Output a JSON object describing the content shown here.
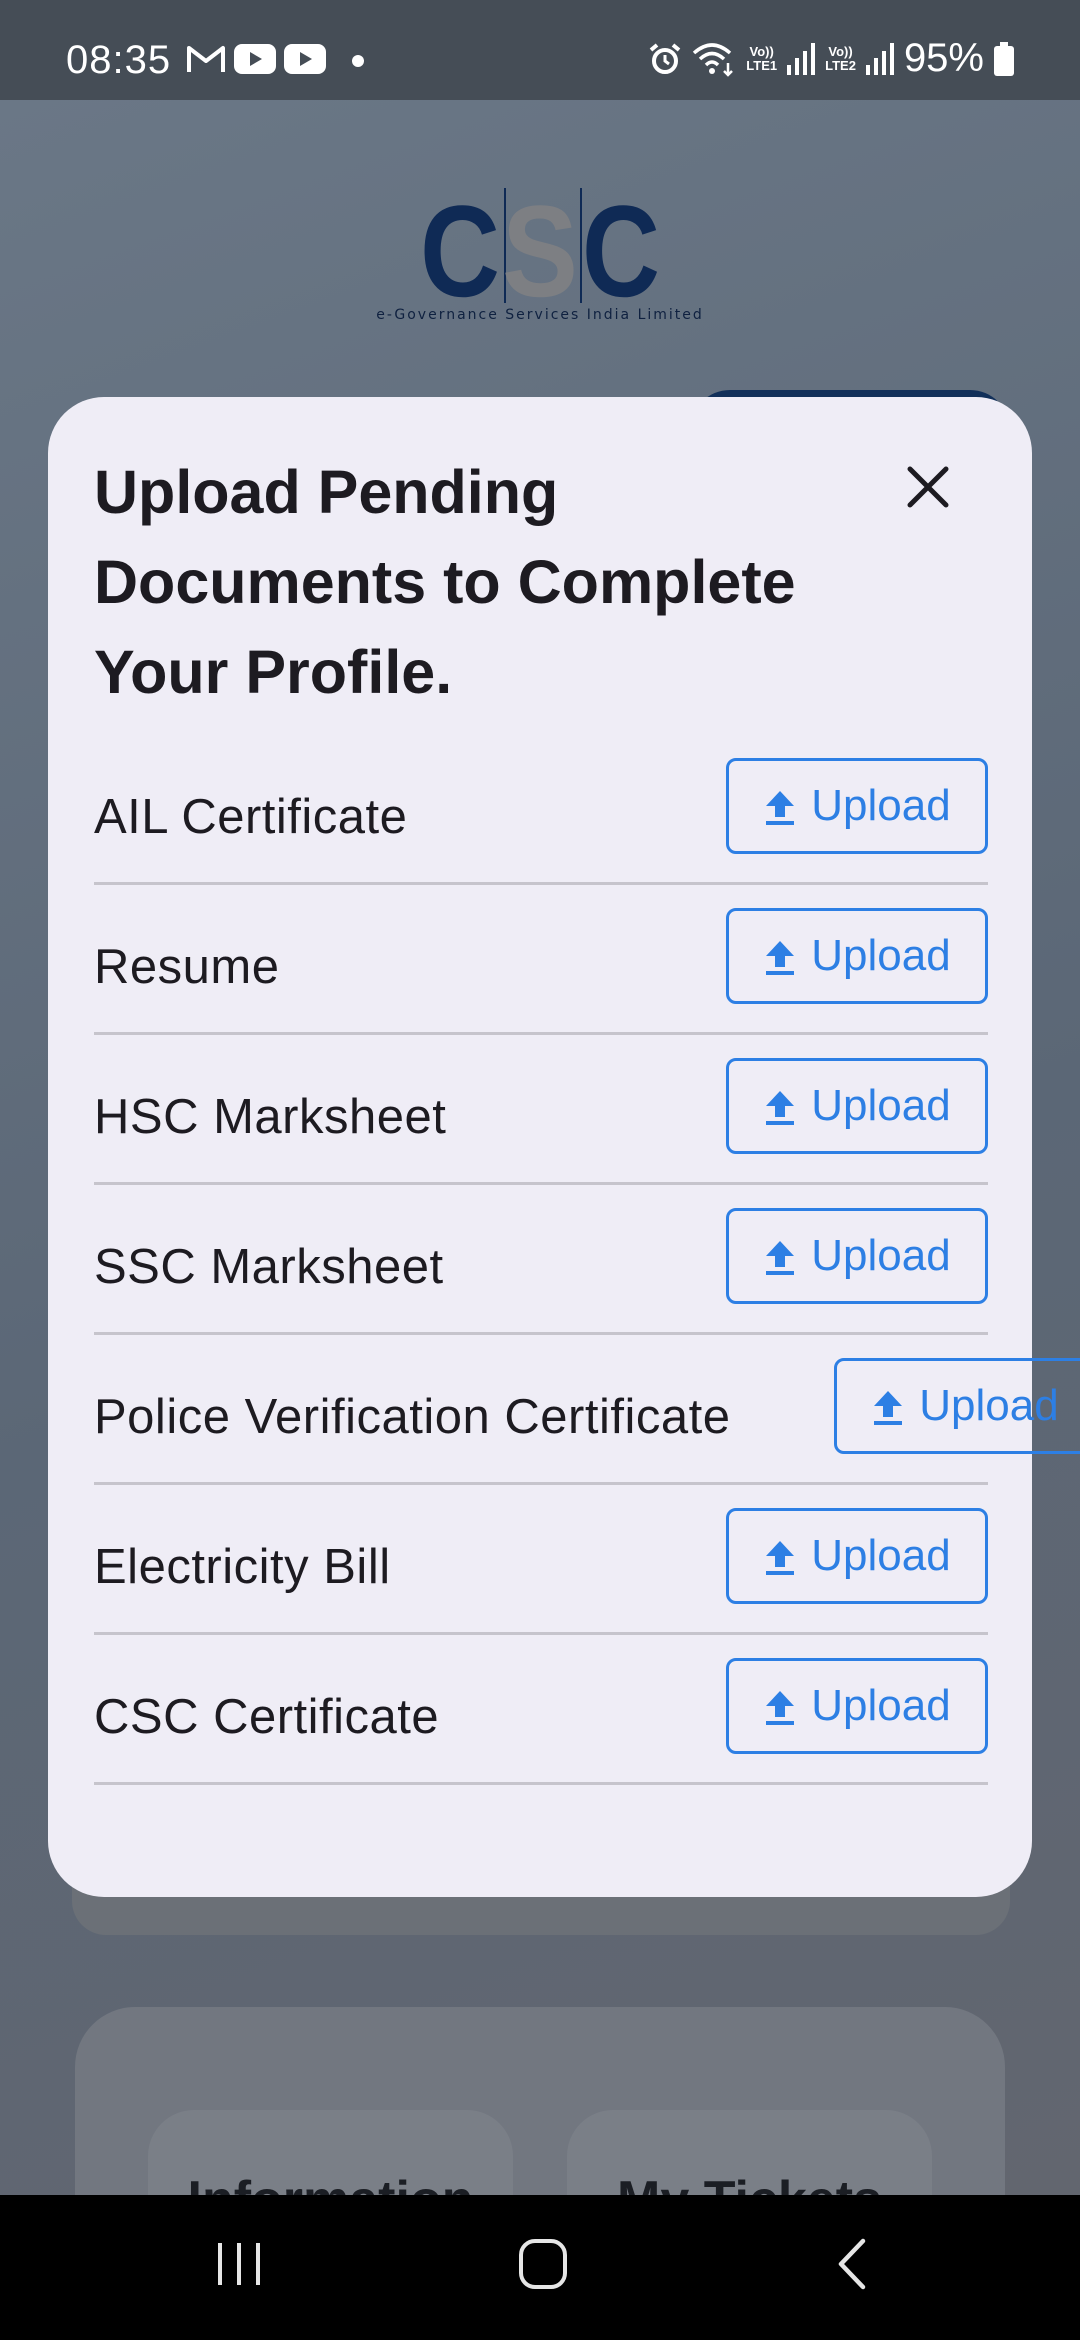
{
  "status_bar": {
    "time": "08:35",
    "battery": "95%",
    "sim1_label": "LTE1",
    "sim2_label": "LTE2",
    "volte_label": "Vo))",
    "icons": [
      "gmail-icon",
      "youtube-icon",
      "youtube-icon",
      "dot-icon",
      "alarm-icon",
      "wifi-icon",
      "signal-icon",
      "signal-icon",
      "battery-icon"
    ]
  },
  "background": {
    "logo_text": "CSC",
    "logo_subtitle": "e-Governance Services India Limited",
    "tiles": [
      "Information",
      "My Tickets"
    ]
  },
  "modal": {
    "title": "Upload Pending Documents to Complete Your Profile.",
    "close_icon": "close-icon",
    "upload_label": "Upload",
    "documents": [
      {
        "label": "AIL Certificate"
      },
      {
        "label": "Resume"
      },
      {
        "label": "HSC Marksheet"
      },
      {
        "label": "SSC Marksheet"
      },
      {
        "label": "Police Verification Certificate"
      },
      {
        "label": "Electricity Bill"
      },
      {
        "label": "CSC Certificate"
      }
    ]
  },
  "nav_bar": {
    "icons": [
      "recent-apps-icon",
      "home-icon",
      "back-icon"
    ]
  },
  "colors": {
    "accent": "#2d7fe4",
    "modal_bg": "#efedf6",
    "logo_blue": "#0f2a55",
    "logo_grey": "#7d7f83"
  }
}
